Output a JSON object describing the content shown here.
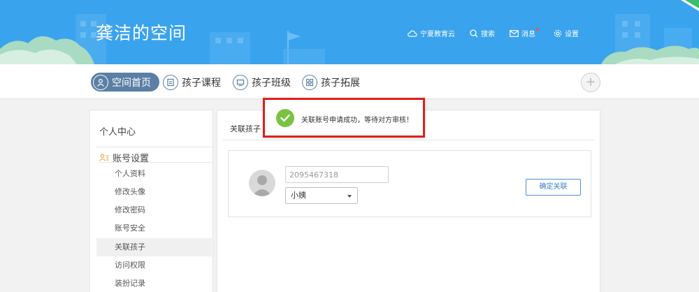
{
  "header": {
    "title": "龚洁的空间",
    "nav": [
      {
        "icon": "cloud-icon",
        "label": "宁夏教育云"
      },
      {
        "icon": "search-icon",
        "label": "搜索"
      },
      {
        "icon": "mail-icon",
        "label": "消息"
      },
      {
        "icon": "gear-icon",
        "label": "设置"
      }
    ]
  },
  "tabs": [
    {
      "icon": "user-icon",
      "label": "空间首页",
      "active": true
    },
    {
      "icon": "monitor-icon",
      "label": "孩子课程"
    },
    {
      "icon": "screen-icon",
      "label": "孩子班级"
    },
    {
      "icon": "grid-icon",
      "label": "孩子拓展"
    }
  ],
  "plus_label": "+",
  "sidebar": {
    "heading": "个人中心",
    "group_label": "账号设置",
    "items": [
      {
        "label": "个人资料"
      },
      {
        "label": "修改头像"
      },
      {
        "label": "修改密码"
      },
      {
        "label": "账号安全"
      },
      {
        "label": "关联孩子",
        "active": true
      },
      {
        "label": "访问权限"
      },
      {
        "label": "装扮记录"
      }
    ]
  },
  "panel": {
    "title": "关联孩子",
    "account_value": "2095467318",
    "relation_value": "小姨",
    "confirm_label": "确定关联"
  },
  "toast": {
    "message": "关联账号申请成功，等待对方审核！"
  },
  "colors": {
    "banner": "#3aa3ee",
    "tab_active": "#5b7fa5",
    "toast_border": "#e0201a",
    "success": "#7cc242",
    "button_border": "#4a90d9"
  }
}
